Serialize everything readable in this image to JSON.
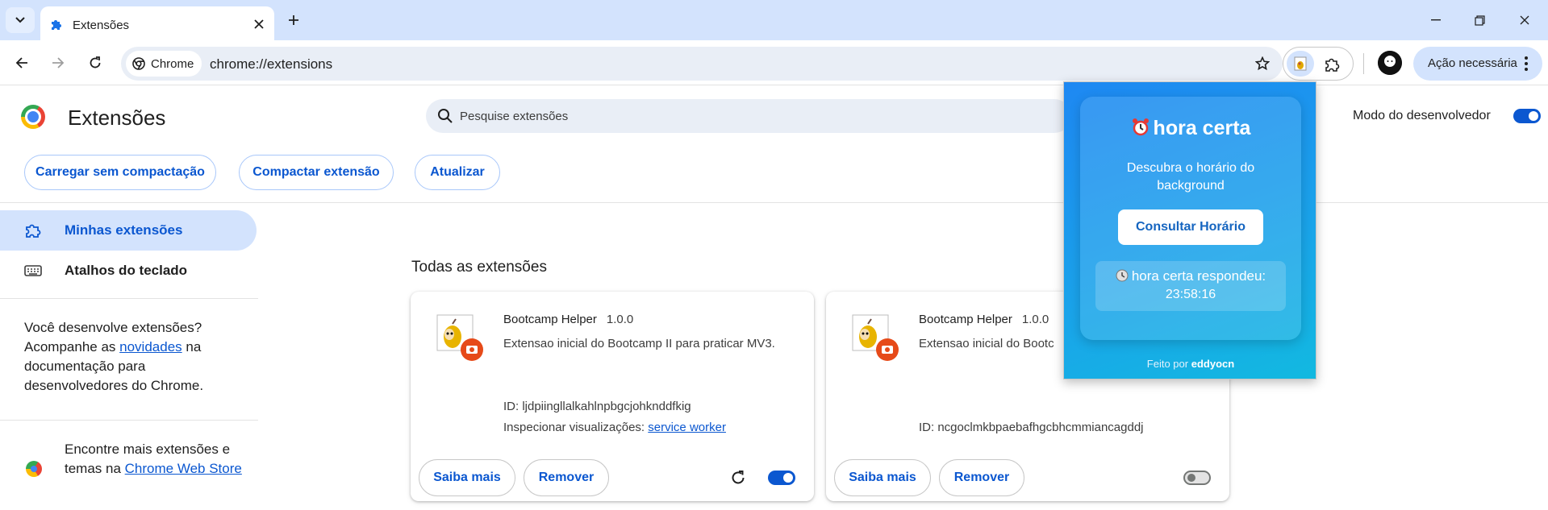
{
  "browser": {
    "tab": {
      "title": "Extensões"
    },
    "omnibox": {
      "chip_label": "Chrome",
      "url": "chrome://extensions"
    },
    "action_pill": {
      "label": "Ação necessária"
    }
  },
  "page": {
    "title": "Extensões",
    "search": {
      "placeholder": "Pesquise extensões"
    },
    "dev_mode": {
      "label": "Modo do desenvolvedor",
      "enabled": true
    },
    "buttons": {
      "load_unpacked": "Carregar sem compactação",
      "pack": "Compactar extensão",
      "update": "Atualizar"
    }
  },
  "sidebar": {
    "items": [
      {
        "label": "Minhas extensões",
        "icon": "extensions-icon",
        "active": true
      },
      {
        "label": "Atalhos do teclado",
        "icon": "keyboard-icon",
        "active": false
      }
    ],
    "dev_note": {
      "before": "Você desenvolve extensões? Acompanhe as ",
      "link": "novidades",
      "after": " na documentação para desenvolvedores do Chrome."
    },
    "store_note": {
      "before": "Encontre mais extensões e temas na ",
      "link": "Chrome Web Store"
    }
  },
  "main": {
    "section_title": "Todas as extensões",
    "cards": [
      {
        "name": "Bootcamp Helper",
        "version": "1.0.0",
        "description": "Extensao inicial do Bootcamp II para praticar MV3.",
        "id": "ID: ljdpiingllalkahlnpbgcjohknddfkig",
        "inspect_label": "Inspecionar visualizações:",
        "inspect_link": "service worker",
        "details_label": "Saiba mais",
        "remove_label": "Remover",
        "enabled": true
      },
      {
        "name": "Bootcamp Helper",
        "version": "1.0.0",
        "description": "Extensao inicial do Bootc",
        "id": "ID: ncgoclmkbpaebafhgcbhcmmiancagddj",
        "details_label": "Saiba mais",
        "remove_label": "Remover",
        "enabled": false
      }
    ]
  },
  "popup": {
    "title": "hora certa",
    "title_icon": "alarm-clock-icon",
    "subtitle": "Descubra o horário do background",
    "button": "Consultar Horário",
    "result_line1": "hora certa respondeu:",
    "result_time": "23:58:16",
    "result_icon": "clock-icon",
    "footer_prefix": "Feito por",
    "footer_author": "eddyocn"
  },
  "colors": {
    "accent": "#0b57d0",
    "tabstrip": "#d3e3fd",
    "popup_gradient_start": "#1e88f2",
    "popup_gradient_end": "#12b9e0"
  }
}
